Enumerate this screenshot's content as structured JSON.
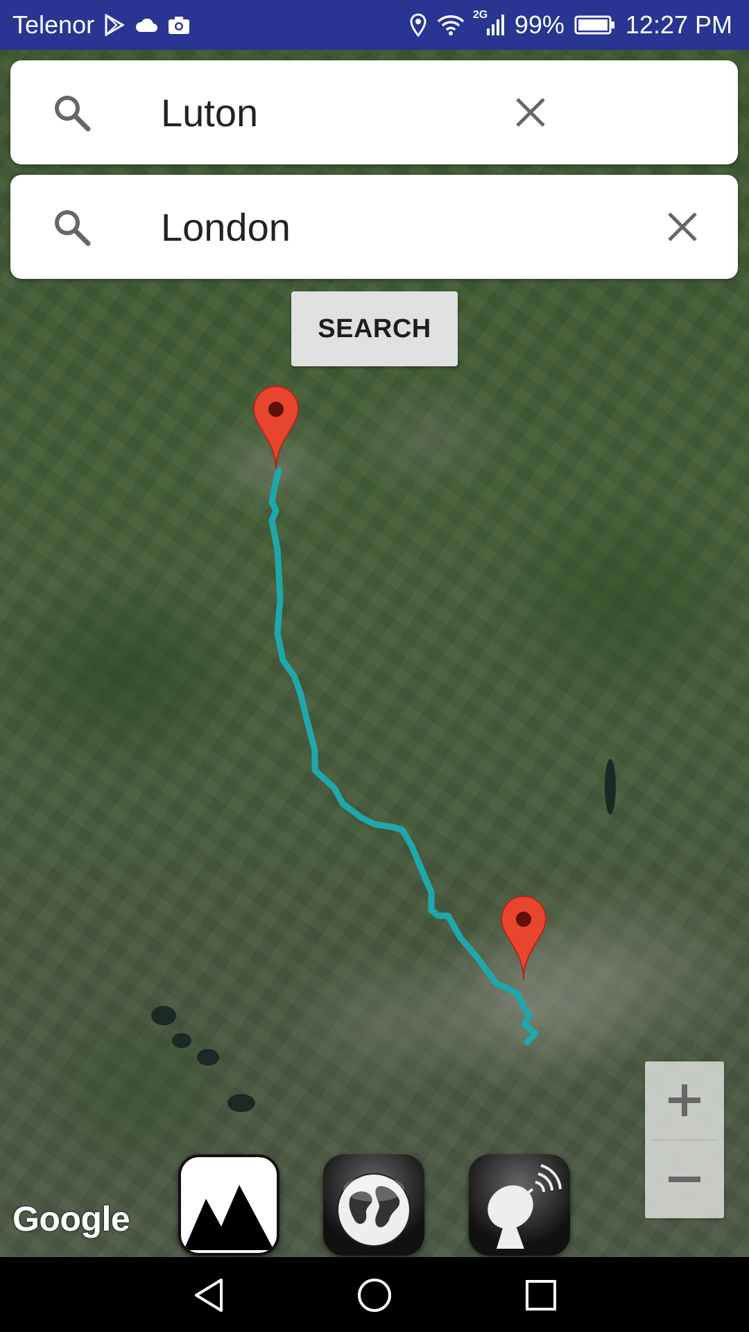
{
  "status_bar": {
    "carrier": "Telenor",
    "network_type": "2G",
    "battery": "99%",
    "time": "12:27 PM",
    "left_icons": [
      "play-store-icon",
      "cloud-icon",
      "camera-icon"
    ],
    "right_icons": [
      "location-icon",
      "wifi-icon",
      "signal-icon",
      "battery-icon"
    ]
  },
  "search": {
    "origin": {
      "value": "Luton"
    },
    "destination": {
      "value": "London"
    },
    "button_label": "SEARCH"
  },
  "map": {
    "attribution": "Google",
    "route_color": "#1fa8ab",
    "marker_color": "#e8452f",
    "markers": [
      "origin-marker",
      "destination-marker"
    ],
    "zoom_in_label": "+",
    "zoom_out_label": "−"
  },
  "mode_buttons": [
    {
      "name": "terrain-mode-button",
      "icon": "mountain-icon"
    },
    {
      "name": "globe-mode-button",
      "icon": "globe-icon"
    },
    {
      "name": "satellite-mode-button",
      "icon": "satellite-dish-icon"
    }
  ],
  "colors": {
    "status_bar": "#283593",
    "nav_bar": "#000000",
    "search_button_bg": "#e0e0e0"
  },
  "nav_bar": {
    "buttons": [
      "back-icon",
      "home-icon",
      "recents-icon"
    ]
  }
}
